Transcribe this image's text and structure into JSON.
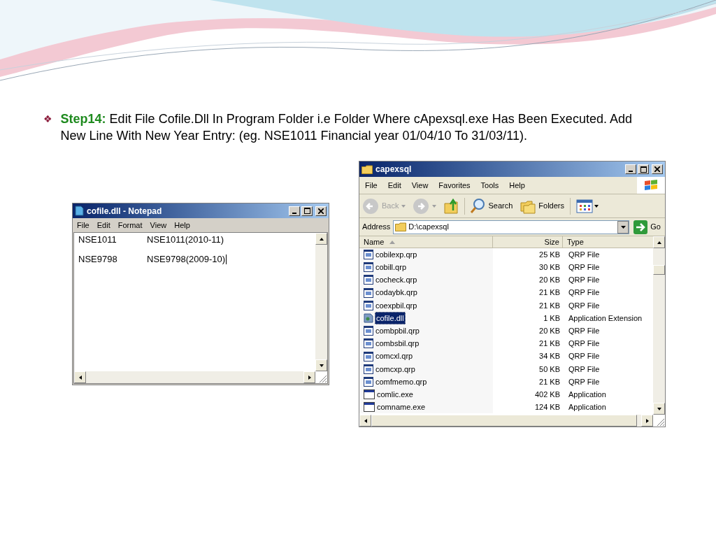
{
  "step": {
    "bullet": "❖",
    "label": "Step14:",
    "text": "Edit File Cofile.Dll In Program Folder i.e Folder Where cApexsql.exe Has Been Executed. Add New Line With New Year Entry:  (eg. NSE1011 Financial year 01/04/10 To 31/03/11)."
  },
  "notepad": {
    "title": "cofile.dll - Notepad",
    "menu": [
      "File",
      "Edit",
      "Format",
      "View",
      "Help"
    ],
    "lines": [
      [
        "NSE1011",
        "NSE1011(2010-11)"
      ],
      [
        "NSE9798",
        "NSE9798(2009-10)"
      ]
    ]
  },
  "explorer": {
    "title": "capexsql",
    "menu": [
      "File",
      "Edit",
      "View",
      "Favorites",
      "Tools",
      "Help"
    ],
    "toolbar": {
      "back": "Back",
      "search": "Search",
      "folders": "Folders"
    },
    "address": {
      "label": "Address",
      "value": "D:\\capexsql",
      "go": "Go"
    },
    "columns": [
      "Name",
      "Size",
      "Type"
    ],
    "files": [
      {
        "name": "cobilexp.qrp",
        "size": "25 KB",
        "type": "QRP File",
        "kind": "qrp",
        "selected": false
      },
      {
        "name": "cobill.qrp",
        "size": "30 KB",
        "type": "QRP File",
        "kind": "qrp",
        "selected": false
      },
      {
        "name": "cocheck.qrp",
        "size": "20 KB",
        "type": "QRP File",
        "kind": "qrp",
        "selected": false
      },
      {
        "name": "codaybk.qrp",
        "size": "21 KB",
        "type": "QRP File",
        "kind": "qrp",
        "selected": false
      },
      {
        "name": "coexpbil.qrp",
        "size": "21 KB",
        "type": "QRP File",
        "kind": "qrp",
        "selected": false
      },
      {
        "name": "cofile.dll",
        "size": "1 KB",
        "type": "Application Extension",
        "kind": "dll",
        "selected": true
      },
      {
        "name": "combpbil.qrp",
        "size": "20 KB",
        "type": "QRP File",
        "kind": "qrp",
        "selected": false
      },
      {
        "name": "combsbil.qrp",
        "size": "21 KB",
        "type": "QRP File",
        "kind": "qrp",
        "selected": false
      },
      {
        "name": "comcxl.qrp",
        "size": "34 KB",
        "type": "QRP File",
        "kind": "qrp",
        "selected": false
      },
      {
        "name": "comcxp.qrp",
        "size": "50 KB",
        "type": "QRP File",
        "kind": "qrp",
        "selected": false
      },
      {
        "name": "comfmemo.qrp",
        "size": "21 KB",
        "type": "QRP File",
        "kind": "qrp",
        "selected": false
      },
      {
        "name": "comlic.exe",
        "size": "402 KB",
        "type": "Application",
        "kind": "exe",
        "selected": false
      },
      {
        "name": "comname.exe",
        "size": "124 KB",
        "type": "Application",
        "kind": "exe",
        "selected": false
      }
    ]
  }
}
